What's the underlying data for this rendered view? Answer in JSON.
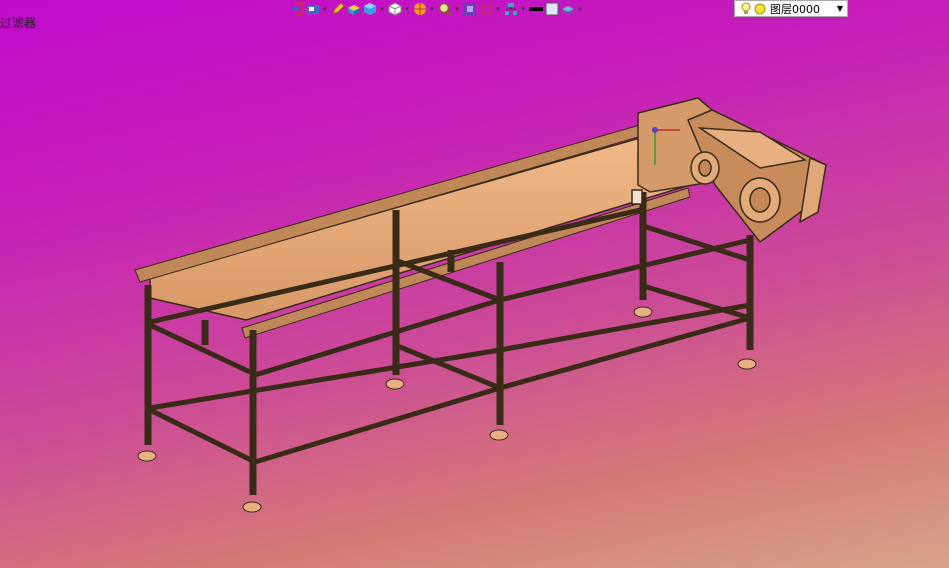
{
  "filter": {
    "label": "过滤器"
  },
  "toolbar": {
    "items": [
      {
        "icon": "exit-icon",
        "caret": false
      },
      {
        "icon": "display-style-icon",
        "caret": true
      },
      {
        "icon": "pencil-icon",
        "caret": false
      },
      {
        "icon": "solid-shade-icon",
        "caret": false
      },
      {
        "icon": "cube-blue-icon",
        "caret": true
      },
      {
        "icon": "cube-white-icon",
        "caret": true
      },
      {
        "icon": "render-icon",
        "caret": true
      },
      {
        "icon": "zoom-icon",
        "caret": true
      },
      {
        "icon": "section-icon",
        "caret": false
      },
      {
        "icon": "clip-icon",
        "caret": true
      },
      {
        "icon": "network-icon",
        "caret": true
      },
      {
        "icon": "line-color-icon",
        "caret": false
      },
      {
        "icon": "fill-color-icon",
        "caret": false
      },
      {
        "icon": "layer-stack-icon",
        "caret": true
      }
    ]
  },
  "layer": {
    "name": "图层0000"
  },
  "colors": {
    "frame": "#3a2a18",
    "wood": "#e8ac78",
    "wood_dark": "#b98358"
  }
}
